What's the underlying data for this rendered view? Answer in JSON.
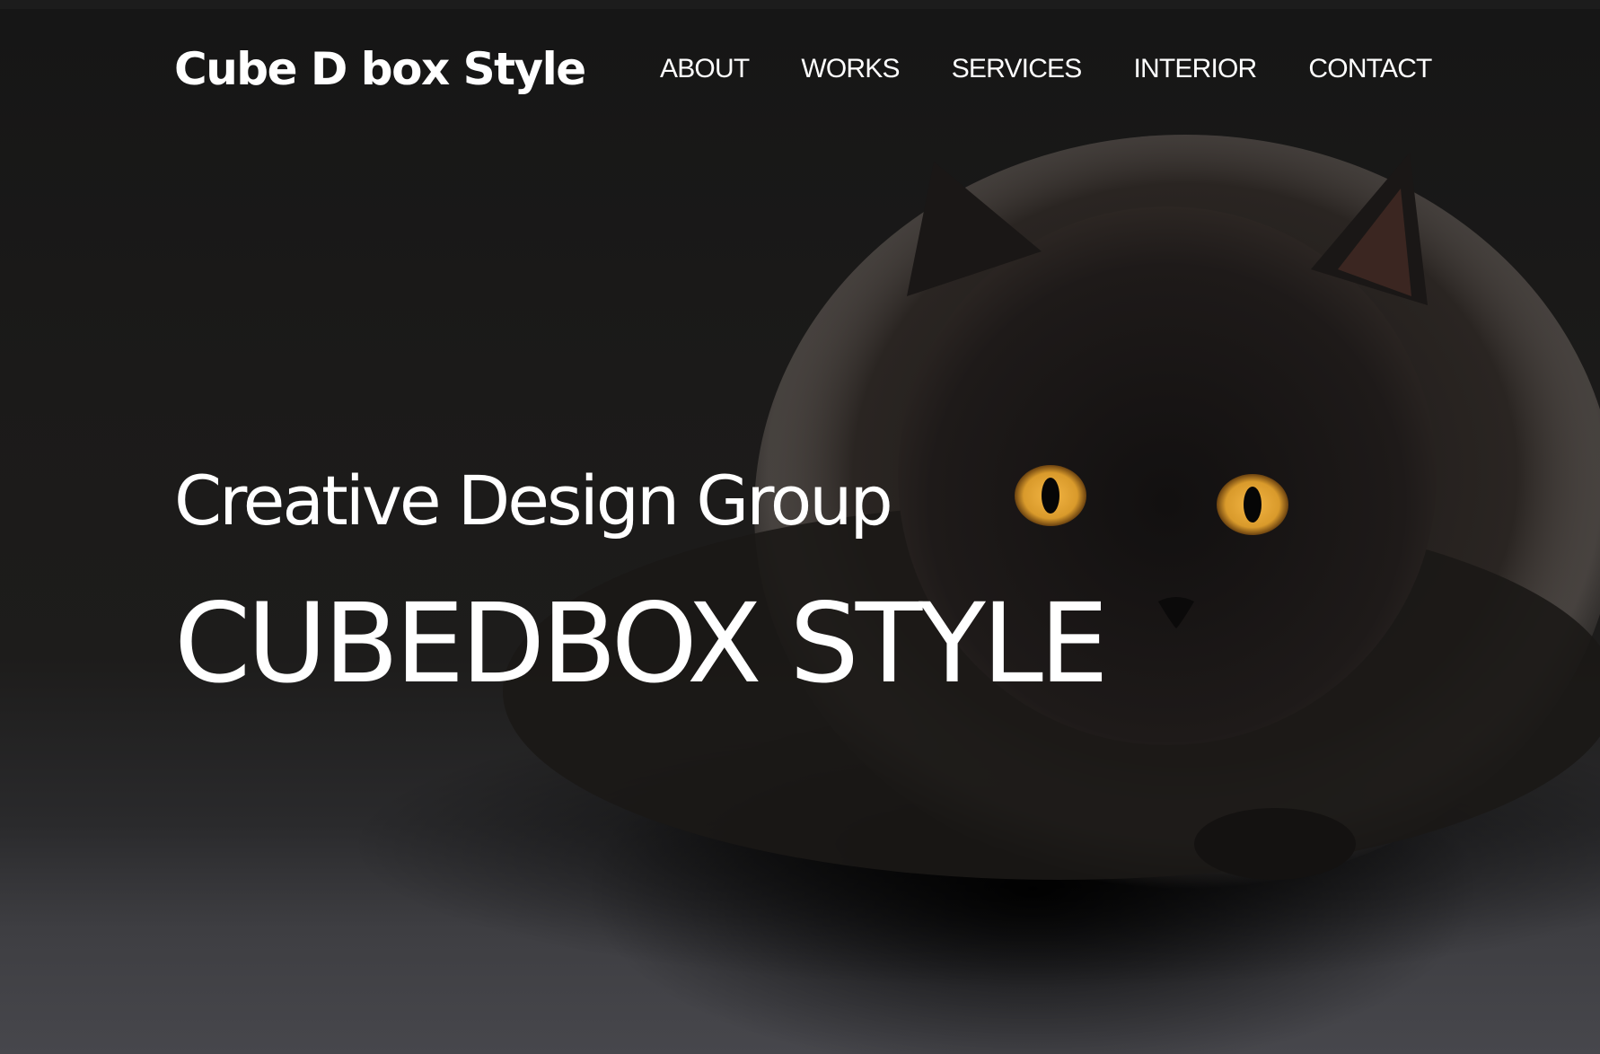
{
  "header": {
    "logo_text": "Cube D box Style",
    "nav": [
      {
        "label": "ABOUT"
      },
      {
        "label": "WORKS"
      },
      {
        "label": "SERVICES"
      },
      {
        "label": "INTERIOR"
      },
      {
        "label": "CONTACT"
      }
    ]
  },
  "hero": {
    "subtitle": "Creative Design Group",
    "title": "CUBEDBOX STYLE",
    "background_image": "black-cat-photo",
    "eye_color": "#d99a2b"
  }
}
